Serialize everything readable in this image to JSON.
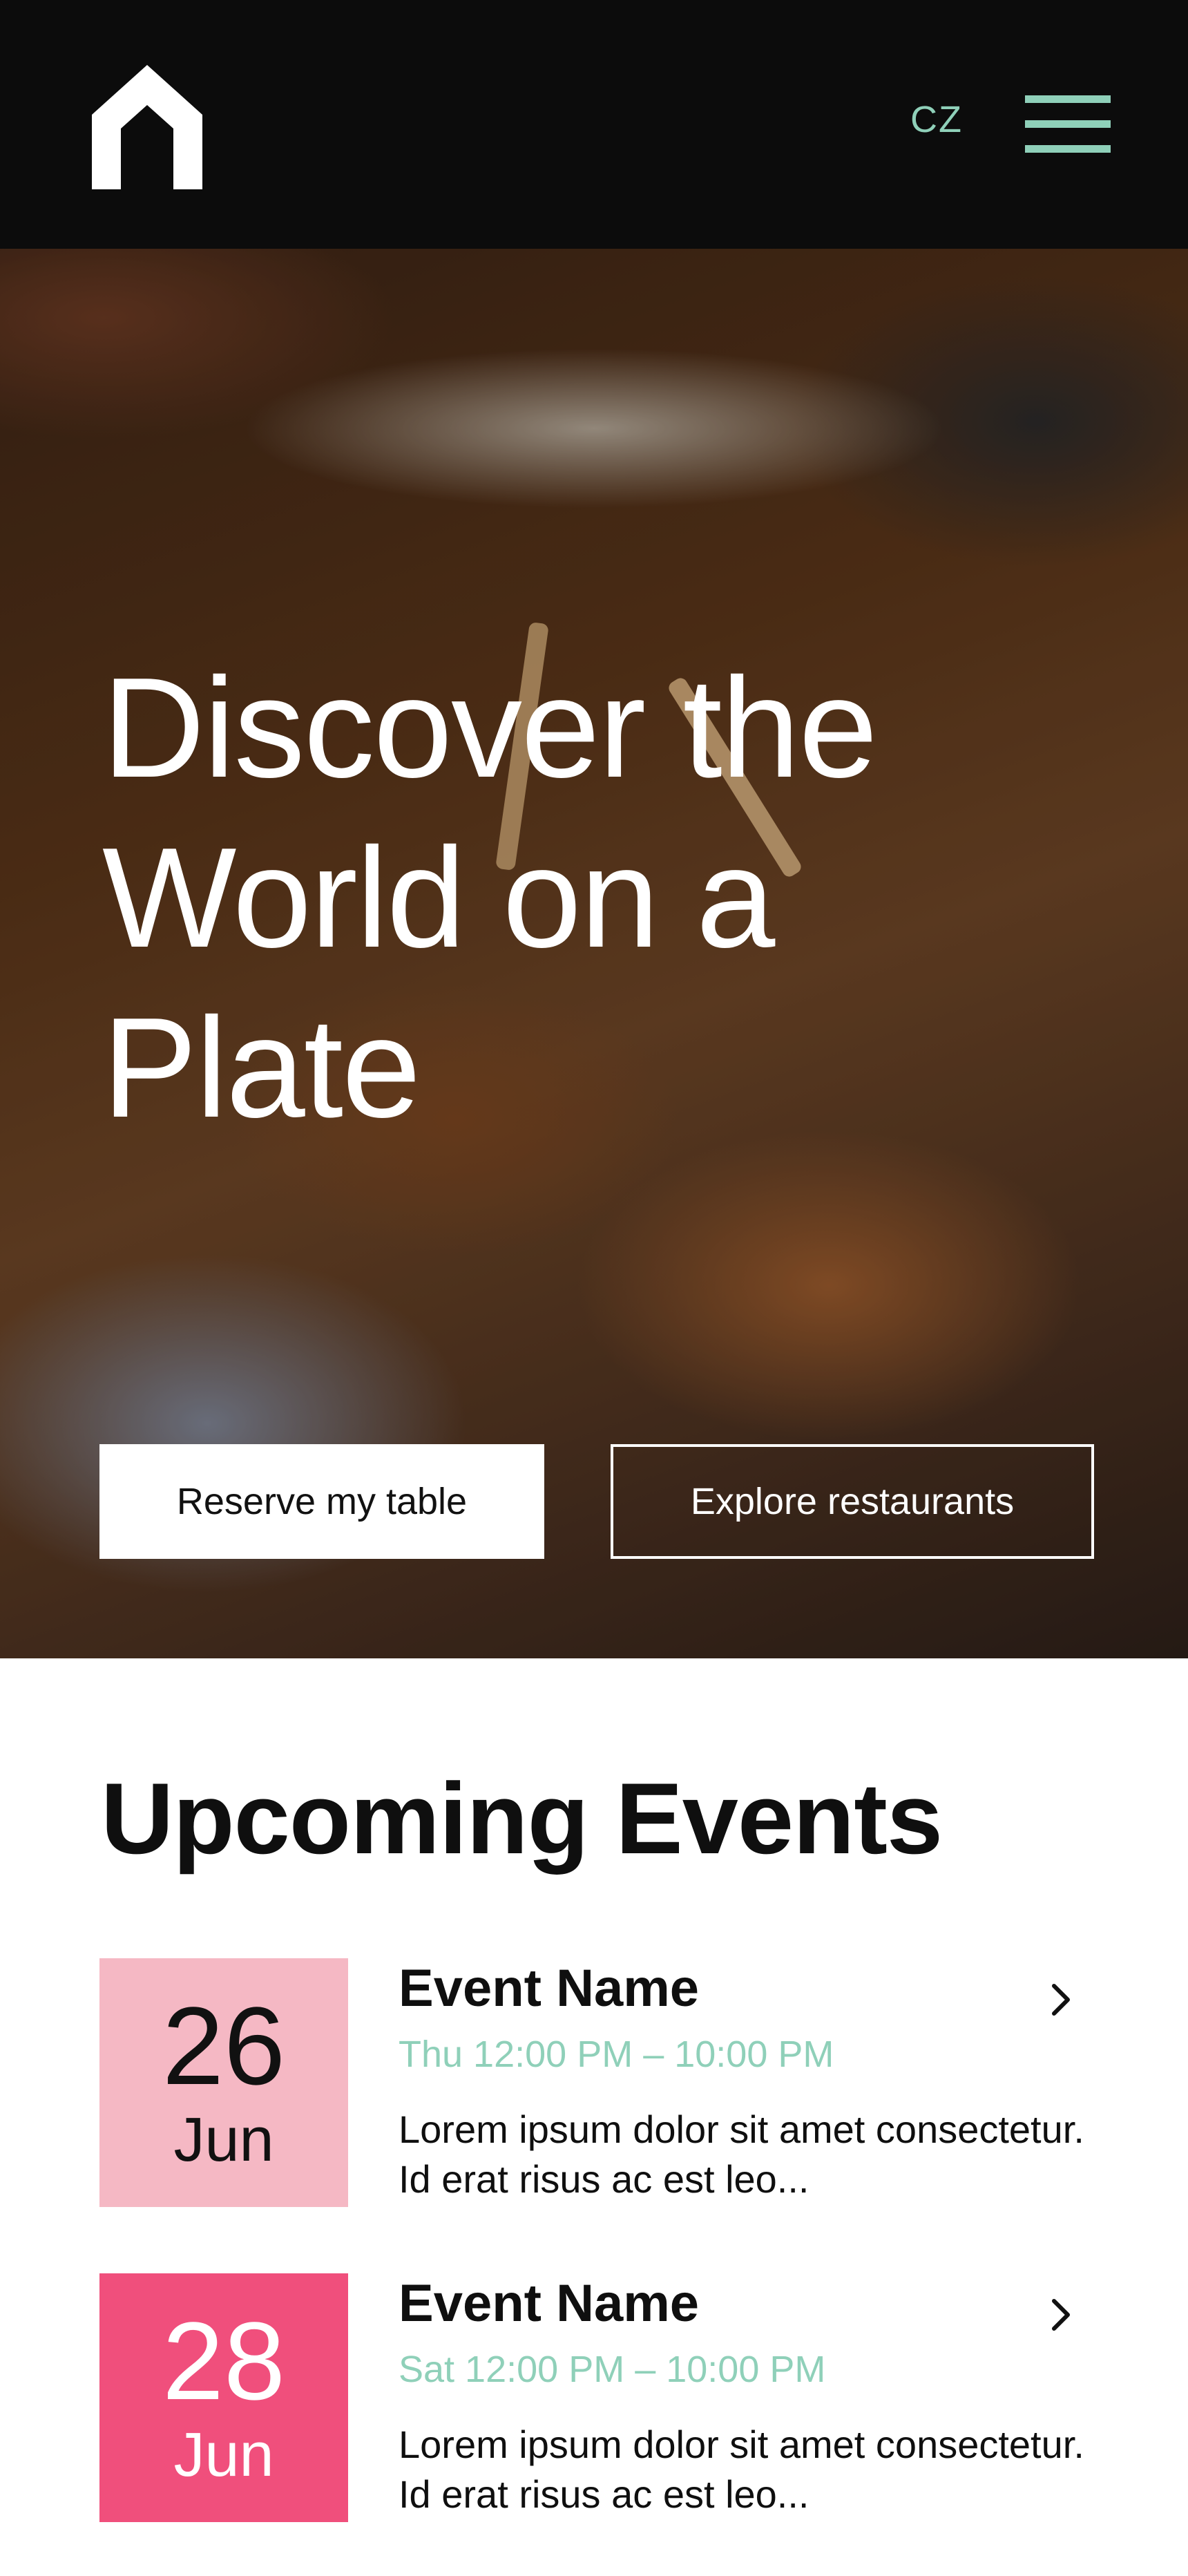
{
  "header": {
    "language": "CZ",
    "icons": {
      "logo": "house-logo-icon",
      "menu": "hamburger-menu-icon"
    }
  },
  "hero": {
    "title": "Discover the World on a Plate",
    "reserve_label": "Reserve my table",
    "explore_label": "Explore restaurants"
  },
  "events": {
    "heading": "Upcoming Events",
    "items": [
      {
        "day": "26",
        "month": "Jun",
        "name": "Event Name",
        "time": "Thu 12:00 PM – 10:00 PM",
        "description": "Lorem ipsum dolor sit amet consectetur. Id erat risus ac est leo...",
        "date_color": "#f5b8c4",
        "date_text_color": "#111111"
      },
      {
        "day": "28",
        "month": "Jun",
        "name": "Event Name",
        "time": "Sat 12:00 PM – 10:00 PM",
        "description": "Lorem ipsum dolor sit amet consectetur. Id erat risus ac est leo...",
        "date_color": "#f04f7c",
        "date_text_color": "#ffffff"
      }
    ]
  },
  "colors": {
    "header_bg": "#0c0c0c",
    "accent": "#8fd0b9",
    "text": "#0f0f0f"
  }
}
